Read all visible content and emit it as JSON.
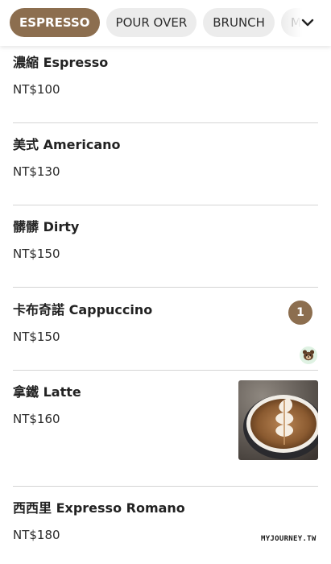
{
  "categories": [
    {
      "label": "ESPRESSO",
      "active": true
    },
    {
      "label": "POUR OVER",
      "active": false
    },
    {
      "label": "BRUNCH",
      "active": false
    },
    {
      "label": "MA",
      "active": false
    }
  ],
  "menu": {
    "items": [
      {
        "name": "濃縮 Espresso",
        "price": "NT$100"
      },
      {
        "name": "美式 Americano",
        "price": "NT$130"
      },
      {
        "name": "髒髒 Dirty",
        "price": "NT$150"
      },
      {
        "name": "卡布奇諾 Cappuccino",
        "price": "NT$150",
        "quantity": "1"
      },
      {
        "name": "拿鐵 Latte",
        "price": "NT$160"
      },
      {
        "name": "西西里 Expresso Romano",
        "price": "NT$180"
      }
    ]
  },
  "watermark": "MYJOURNEY.TW",
  "colors": {
    "accent": "#8c6e4f",
    "chip_bg": "#ececec",
    "divider": "#d4d4d4"
  },
  "icons": {
    "dropdown": "chevron-down-icon",
    "badge_helper": "bear-icon"
  }
}
